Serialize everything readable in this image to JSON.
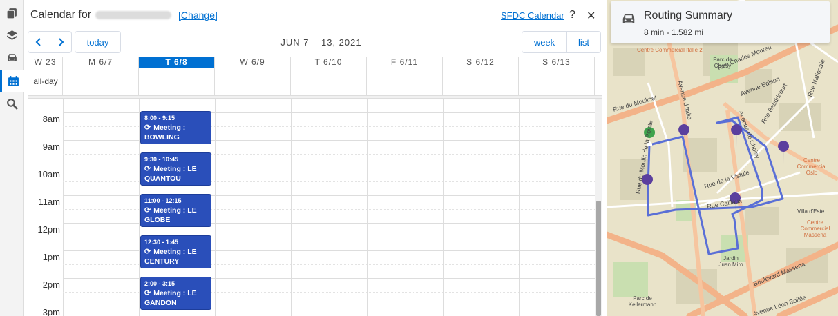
{
  "rail": {
    "items": [
      "copy-icon",
      "layers-icon",
      "car-icon",
      "calendar-icon",
      "search-icon"
    ],
    "active": "calendar-icon"
  },
  "calendar": {
    "title_prefix": "Calendar for",
    "change_label": "[Change]",
    "sfdc_label": "SFDC Calendar",
    "help_label": "?",
    "close_label": "✕",
    "prev_label": "‹",
    "next_label": "›",
    "today_label": "today",
    "range_title": "JUN 7 – 13, 2021",
    "view_week": "week",
    "view_list": "list",
    "week_label": "W 23",
    "days": [
      "M 6/7",
      "T 6/8",
      "W 6/9",
      "T 6/10",
      "F 6/11",
      "S 6/12",
      "S 6/13"
    ],
    "today_index": 1,
    "allday_label": "all-day",
    "hours": [
      "8am",
      "9am",
      "10am",
      "11am",
      "12pm",
      "1pm",
      "2pm",
      "3pm"
    ],
    "events": [
      {
        "time": "8:00 - 9:15",
        "name": "Meeting : BOWLING"
      },
      {
        "time": "9:30 - 10:45",
        "name": "Meeting : LE QUANTOU"
      },
      {
        "time": "11:00 - 12:15",
        "name": "Meeting : LE GLOBE"
      },
      {
        "time": "12:30 - 1:45",
        "name": "Meeting : LE CENTURY"
      },
      {
        "time": "2:00 - 3:15",
        "name": "Meeting : LE GANDON"
      }
    ]
  },
  "routing": {
    "title": "Routing Summary",
    "summary": "8 min - 1.582 mi"
  },
  "map": {
    "labels": [
      "Centre Commercial Italie 2",
      "Parc de Choisy",
      "Avenue Edison",
      "Rue Charles Moureu",
      "Rue Baudricourt",
      "Rue Nationale",
      "Rue du Moulinet",
      "Avenue d'Italie",
      "Avenue de Choisy",
      "Centre Commercial Oslo",
      "Rue du Moulin de la Pointe",
      "Rue de la Vistule",
      "Rue Caillaux",
      "Villa d'Este",
      "Centre Commercial Massena",
      "Parc de Kellermann",
      "Jardin Juan Miro",
      "Boulevard Massena",
      "Avenue Léon Bollée"
    ],
    "colors": {
      "route": "#5a6fd6",
      "pin": "#5b3f9e",
      "start": "#3fa34d"
    }
  }
}
